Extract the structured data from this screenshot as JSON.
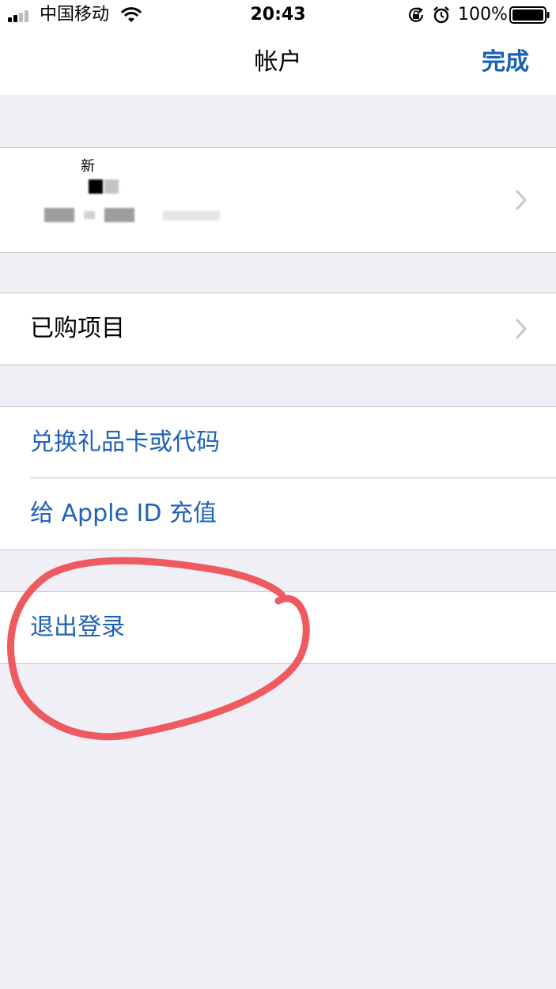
{
  "status_bar": {
    "carrier": "中国移动",
    "time": "20:43",
    "battery_percent": "100%"
  },
  "nav": {
    "title": "帐户",
    "done_label": "完成"
  },
  "profile": {
    "name_partial": "新"
  },
  "purchased": {
    "label": "已购项目"
  },
  "actions": {
    "redeem_label": "兑换礼品卡或代码",
    "add_funds_label": "给 Apple ID 充值"
  },
  "sign_out": {
    "label": "退出登录"
  },
  "colors": {
    "link_blue": "#2061b8",
    "done_blue": "#1a5fb4",
    "grouped_background": "#efeff5",
    "annotation_red": "#ee5a5f"
  },
  "icons": [
    "signal-bars-icon",
    "wifi-icon",
    "rotation-lock-icon",
    "alarm-icon",
    "battery-icon",
    "chevron-right-icon"
  ]
}
